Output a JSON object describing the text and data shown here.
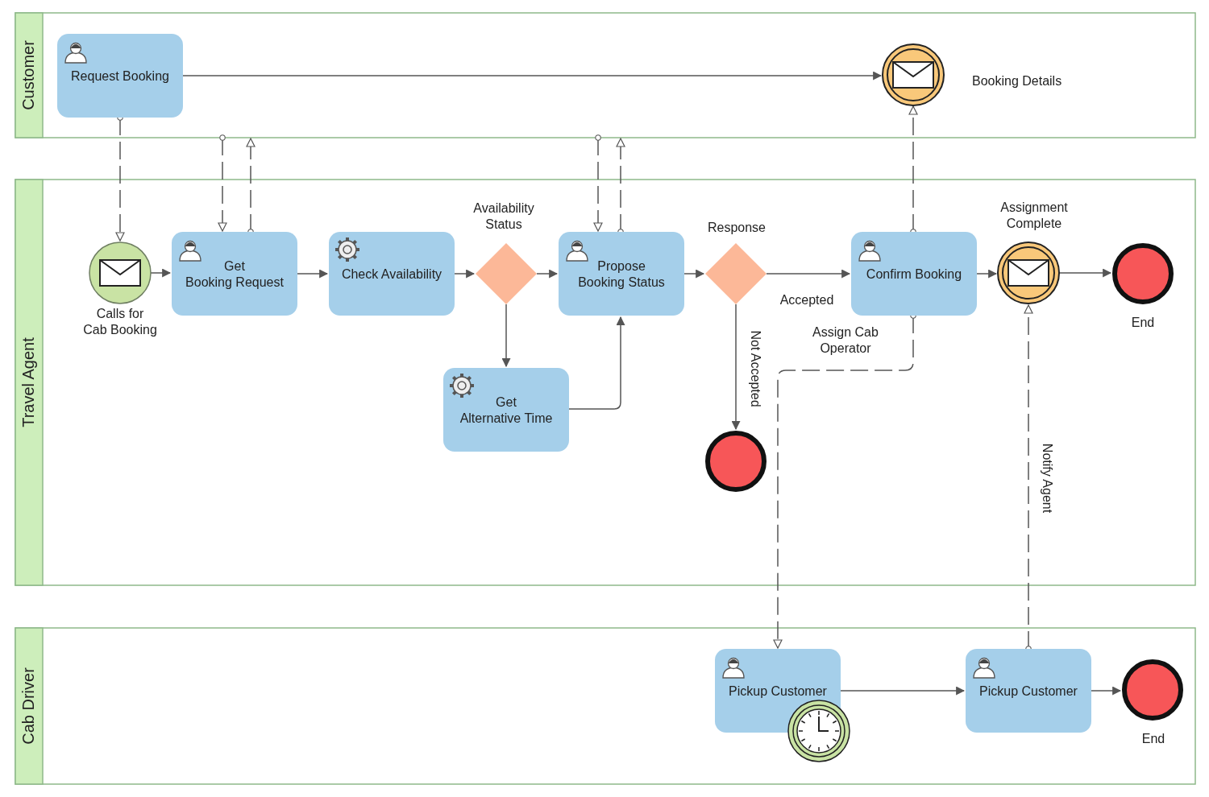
{
  "lanes": [
    {
      "label": "Customer"
    },
    {
      "label": "Travel Agent"
    },
    {
      "label": "Cab Driver"
    }
  ],
  "tasks": [
    {
      "label": [
        "Request Booking"
      ],
      "kind": "user"
    },
    {
      "label": [
        "Get",
        "Booking Request"
      ],
      "kind": "user"
    },
    {
      "label": [
        "Check Availability"
      ],
      "kind": "service"
    },
    {
      "label": [
        "Get",
        "Alternative Time"
      ],
      "kind": "service"
    },
    {
      "label": [
        "Propose",
        "Booking Status"
      ],
      "kind": "user"
    },
    {
      "label": [
        "Confirm Booking"
      ],
      "kind": "user"
    },
    {
      "label": [
        "Pickup Customer"
      ],
      "kind": "user"
    },
    {
      "label": [
        "Pickup Customer"
      ],
      "kind": "user"
    }
  ],
  "events": [
    {
      "kind": "message-start",
      "label": [
        "Calls for",
        "Cab Booking"
      ]
    },
    {
      "kind": "message",
      "label": [
        "Booking Details"
      ]
    },
    {
      "kind": "message",
      "label": [
        "Assignment",
        "Complete"
      ]
    },
    {
      "kind": "end",
      "label": [
        "End"
      ]
    },
    {
      "kind": "end"
    },
    {
      "kind": "end",
      "label": [
        "End"
      ]
    },
    {
      "kind": "timer"
    }
  ],
  "gateways": [
    {
      "label": [
        "Availability",
        "Status"
      ]
    },
    {
      "label": [
        "Response"
      ]
    }
  ],
  "flow_labels": [
    {
      "label": [
        "Accepted"
      ],
      "kind": "horizontal"
    },
    {
      "label": [
        "Not Accepted"
      ],
      "kind": "vertical"
    },
    {
      "label": [
        "Assign Cab",
        "Operator"
      ],
      "kind": "horizontal"
    },
    {
      "label": [
        "Notify Agent"
      ],
      "kind": "vertical"
    }
  ]
}
